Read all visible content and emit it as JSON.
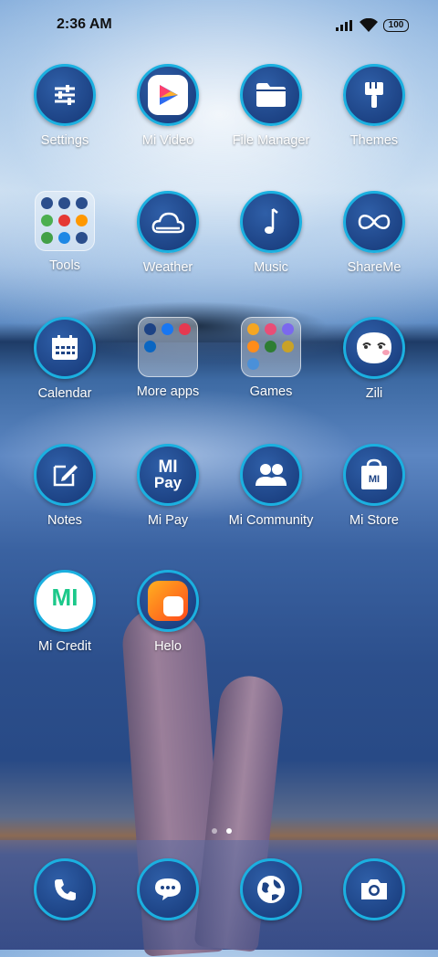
{
  "status_bar": {
    "time": "2:36 AM",
    "battery": "100",
    "icons": [
      "signal-icon",
      "wifi-icon",
      "battery-icon"
    ]
  },
  "apps": [
    {
      "label": "Settings",
      "icon": "settings-sliders-icon"
    },
    {
      "label": "Mi Video",
      "icon": "mi-video-icon"
    },
    {
      "label": "File Manager",
      "icon": "folder-icon"
    },
    {
      "label": "Themes",
      "icon": "brush-icon"
    },
    {
      "label": "Tools",
      "icon": "tools-folder-icon"
    },
    {
      "label": "Weather",
      "icon": "weather-cloud-icon"
    },
    {
      "label": "Music",
      "icon": "music-note-icon"
    },
    {
      "label": "ShareMe",
      "icon": "infinity-icon"
    },
    {
      "label": "Calendar",
      "icon": "calendar-icon"
    },
    {
      "label": "More apps",
      "icon": "more-apps-folder-icon"
    },
    {
      "label": "Games",
      "icon": "games-folder-icon"
    },
    {
      "label": "Zili",
      "icon": "zili-face-icon"
    },
    {
      "label": "Notes",
      "icon": "note-edit-icon"
    },
    {
      "label": "Mi Pay",
      "icon": "mi-pay-icon",
      "text": "MI\nPay"
    },
    {
      "label": "Mi Community",
      "icon": "people-icon"
    },
    {
      "label": "Mi Store",
      "icon": "store-bag-icon",
      "text": "MI"
    },
    {
      "label": "Mi Credit",
      "icon": "mi-credit-icon",
      "text": "MI"
    },
    {
      "label": "Helo",
      "icon": "helo-icon"
    }
  ],
  "dock": [
    {
      "icon": "phone-icon"
    },
    {
      "icon": "messages-icon"
    },
    {
      "icon": "browser-globe-icon"
    },
    {
      "icon": "camera-icon"
    }
  ],
  "page_indicator": {
    "count": 2,
    "active": 2
  },
  "colors": {
    "icon_bg": "#1d4385",
    "icon_ring": "#1bb0e0"
  }
}
